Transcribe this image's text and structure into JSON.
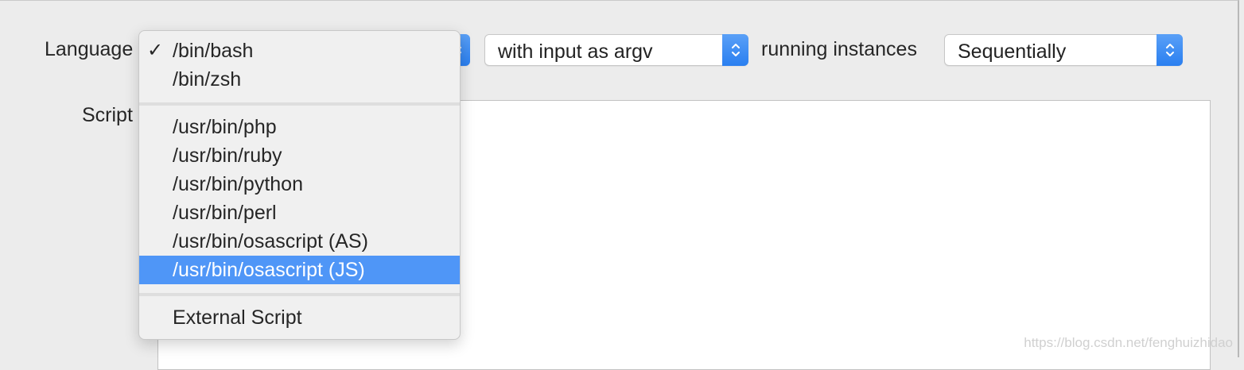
{
  "form": {
    "language_label": "Language",
    "script_label": "Script",
    "input_popup_value": "with input as argv",
    "running_label": "running instances",
    "running_popup_value": "Sequentially"
  },
  "language_menu": {
    "items": [
      {
        "label": "/bin/bash",
        "checked": true
      },
      {
        "label": "/bin/zsh"
      },
      {
        "label": "/usr/bin/php"
      },
      {
        "label": "/usr/bin/ruby"
      },
      {
        "label": "/usr/bin/python"
      },
      {
        "label": "/usr/bin/perl"
      },
      {
        "label": "/usr/bin/osascript (AS)"
      },
      {
        "label": "/usr/bin/osascript (JS)",
        "highlighted": true
      },
      {
        "label": "External Script"
      }
    ],
    "check_mark": "✓"
  },
  "watermark": "https://blog.csdn.net/fenghuizhidao",
  "colors": {
    "accent": "#2a7ff0",
    "highlight": "#4f96f7"
  },
  "icons": {
    "stepper": "up-down-chevron-icon",
    "check": "checkmark-icon"
  }
}
